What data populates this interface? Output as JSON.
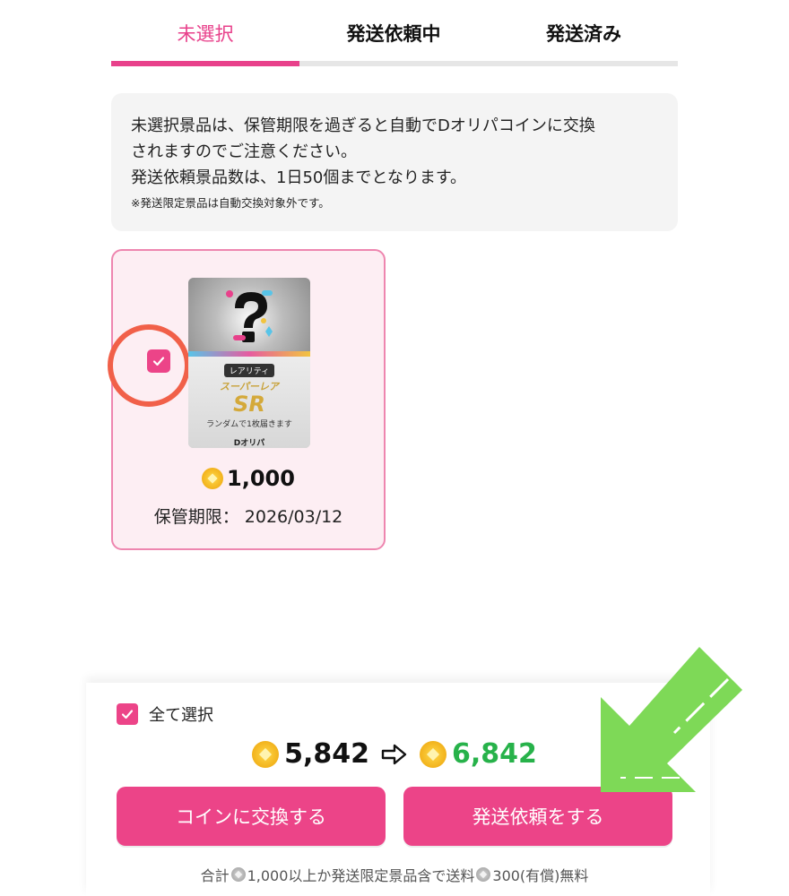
{
  "tabs": [
    {
      "label": "未選択",
      "active": true
    },
    {
      "label": "発送依頼中",
      "active": false
    },
    {
      "label": "発送済み",
      "active": false
    }
  ],
  "notice": {
    "line1": "未選択景品は、保管期限を過ぎると自動でDオリパコインに交換",
    "line2": "されますのでご注意ください。",
    "line3": "発送依頼景品数は、1日50個までとなります。",
    "line4": "※発送限定景品は自動交換対象外です。"
  },
  "card": {
    "checked": true,
    "image": {
      "rarity_tag": "レアリティ",
      "rarity_name": "スーパーレア",
      "rarity_code": "SR",
      "note": "ランダムで1枚届きます",
      "logo": "Dオリパ"
    },
    "price": "1,000",
    "expiry_label": "保管期限：",
    "expiry_date": "2026/03/12"
  },
  "footer": {
    "select_all_label": "全て選択",
    "current_coins": "5,842",
    "next_coins": "6,842",
    "exchange_button": "コインに交換する",
    "request_button": "発送依頼をする",
    "note_prefix": "合計",
    "note_mid": "1,000以上か発送限定景品含で送料",
    "note_suffix": "300(有償)無料"
  },
  "colors": {
    "accent_pink": "#ec4488",
    "tab_active": "#e8418b",
    "next_coins_green": "#27b24a",
    "highlight_ring": "#f16049",
    "annotation_arrow": "#7ed957"
  },
  "icons": [
    "check-icon",
    "coin-icon",
    "arrow-right-icon",
    "question-mark-icon",
    "annotation-arrow-icon"
  ]
}
